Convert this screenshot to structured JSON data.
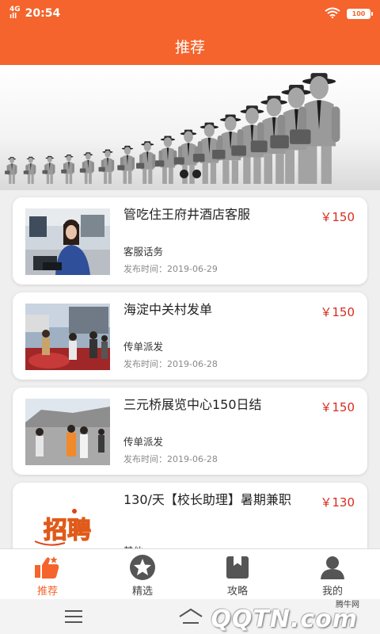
{
  "status_bar": {
    "network": "4G",
    "signal_label": "ıll",
    "time": "20:54",
    "battery": "100"
  },
  "header": {
    "title": "推荐"
  },
  "banner": {
    "page_count": 2
  },
  "jobs": [
    {
      "title": "管吃住王府井酒店客服",
      "price": "￥150",
      "tag": "客服话务",
      "date": "发布时间：2019-06-29"
    },
    {
      "title": "海淀中关村发单",
      "price": "￥150",
      "tag": "传单派发",
      "date": "发布时间：2019-06-28"
    },
    {
      "title": "三元桥展览中心150日结",
      "price": "￥150",
      "tag": "传单派发",
      "date": "发布时间：2019-06-28"
    },
    {
      "title": "130/天【校长助理】暑期兼职",
      "price": "￥130",
      "tag": "其他",
      "date": "",
      "thumb_text": "招聘"
    }
  ],
  "tabs": [
    {
      "label": "推荐",
      "icon": "thumbs-up-icon",
      "active": true
    },
    {
      "label": "精选",
      "icon": "star-icon",
      "active": false
    },
    {
      "label": "攻略",
      "icon": "bookmark-icon",
      "active": false
    },
    {
      "label": "我的",
      "icon": "user-icon",
      "active": false
    }
  ],
  "watermark": {
    "small_text": "腾牛网",
    "logo_text": "QQTN.com"
  },
  "colors": {
    "brand": "#f4642c",
    "price": "#d82c1f",
    "tab_inactive": "#444444"
  }
}
